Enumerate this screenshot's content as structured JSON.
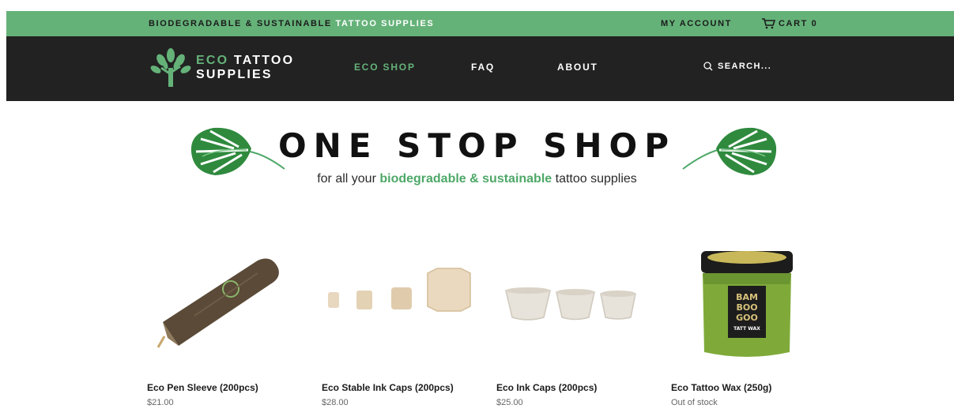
{
  "topbar": {
    "promo_prefix": "BIODEGRADABLE & SUSTAINABLE ",
    "promo_highlight": "TATTOO SUPPLIES",
    "account_label": "MY ACCOUNT",
    "cart_label": "CART 0",
    "bg_color": "#65b279"
  },
  "nav": {
    "logo_line1_a": "ECO",
    "logo_line1_b": " TATTOO",
    "logo_line2": "SUPPLIES",
    "links": [
      {
        "label": "ECO SHOP",
        "active": true
      },
      {
        "label": "FAQ",
        "active": false
      },
      {
        "label": "ABOUT",
        "active": false
      }
    ],
    "search_placeholder": "SEARCH...",
    "bg_color": "#222222",
    "accent_color": "#65b279"
  },
  "hero": {
    "title": "ONE STOP SHOP",
    "tagline_prefix": "for all your ",
    "tagline_highlight": "biodegradable & sustainable",
    "tagline_suffix": " tattoo supplies"
  },
  "products": [
    {
      "name": "Eco Pen Sleeve (200pcs)",
      "price": "$21.00",
      "image_icon": "pen-sleeve-image"
    },
    {
      "name": "Eco Stable Ink Caps (200pcs)",
      "price": "$28.00",
      "image_icon": "stable-ink-caps-image"
    },
    {
      "name": "Eco Ink Caps (200pcs)",
      "price": "$25.00",
      "image_icon": "ink-caps-image"
    },
    {
      "name": "Eco Tattoo Wax (250g)",
      "price": "Out of stock",
      "image_icon": "tattoo-wax-jar-image",
      "jar_label": "BAM BOO GOO",
      "jar_sublabel": "TATT WAX"
    }
  ]
}
